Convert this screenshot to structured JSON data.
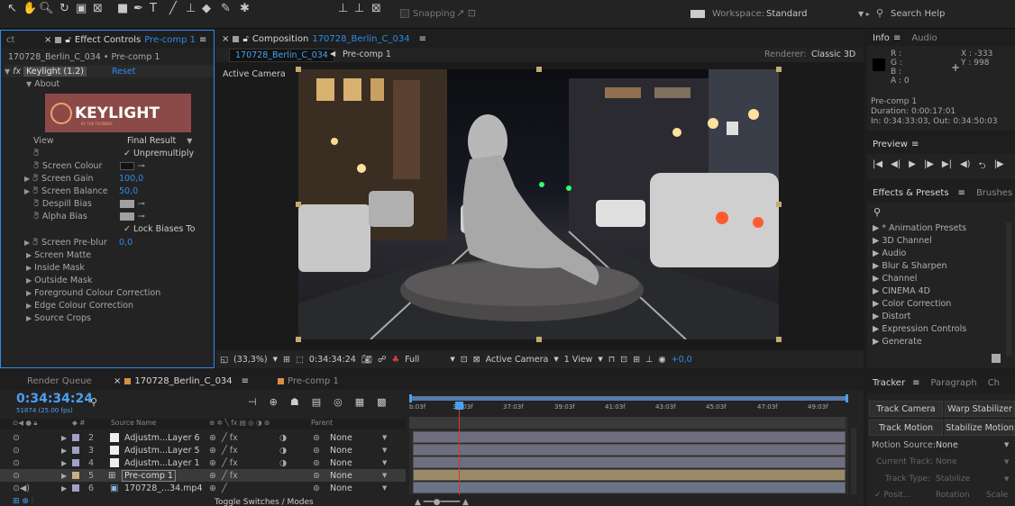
{
  "toolbar": {
    "snapping": "Snapping",
    "workspace_label": "Workspace:",
    "workspace_value": "Standard",
    "search_placeholder": "Search Help"
  },
  "effect_controls": {
    "tab_left": "ct",
    "tab_label": "Effect Controls",
    "tab_comp": "Pre-comp 1",
    "menu": "≡",
    "breadcrumb": "170728_Berlin_C_034 • Pre-comp 1",
    "effect_name": "Keylight (1.2)",
    "reset": "Reset",
    "about": "About",
    "logo_text": "KEYLIGHT",
    "logo_sub": "BY THE FOUNDRY",
    "view_label": "View",
    "view_value": "Final Result",
    "unpremultiply": "Unpremultiply",
    "screen_colour": "Screen Colour",
    "screen_gain": "Screen Gain",
    "screen_gain_val": "100,0",
    "screen_balance": "Screen Balance",
    "screen_balance_val": "50,0",
    "despill_bias": "Despill Bias",
    "alpha_bias": "Alpha Bias",
    "lock_biases": "Lock Biases To",
    "screen_preblur": "Screen Pre-blur",
    "screen_preblur_val": "0,0",
    "groups": [
      "Screen Matte",
      "Inside Mask",
      "Outside Mask",
      "Foreground Colour Correction",
      "Edge Colour Correction",
      "Source Crops"
    ]
  },
  "composition": {
    "tab_label": "Composition",
    "tab_comp": "170728_Berlin_C_034",
    "menu": "≡",
    "subtab_active": "170728_Berlin_C_034",
    "subtab_other": "Pre-comp 1",
    "renderer_label": "Renderer:",
    "renderer_value": "Classic 3D",
    "active_camera": "Active Camera",
    "zoom": "(33,3%)",
    "timecode": "0:34:34:24",
    "resolution": "Full",
    "camera": "Active Camera",
    "view_count": "1 View",
    "exposure": "+0,0"
  },
  "info": {
    "tab": "Info",
    "tab2": "Audio",
    "r": "R :",
    "g": "G :",
    "b": "B :",
    "a": "A : 0",
    "x": "X : -333",
    "y": "Y : 998",
    "layer_name": "Pre-comp 1",
    "duration": "Duration: 0:00:17:01",
    "inout": "In: 0:34:33:03, Out: 0:34:50:03"
  },
  "preview": {
    "tab": "Preview"
  },
  "effects_presets": {
    "tab": "Effects & Presets",
    "tab2": "Brushes",
    "items": [
      "* Animation Presets",
      "3D Channel",
      "Audio",
      "Blur & Sharpen",
      "Channel",
      "CINEMA 4D",
      "Color Correction",
      "Distort",
      "Expression Controls",
      "Generate"
    ]
  },
  "timeline": {
    "render_queue": "Render Queue",
    "tab_comp": "170728_Berlin_C_034",
    "tab_comp2": "Pre-comp 1",
    "timecode": "0:34:34:24",
    "fps": "51874 (25.00 fps)",
    "col_source": "Source Name",
    "col_parent": "Parent",
    "ticks": [
      "b:03f",
      "35:03f",
      "37:03f",
      "39:03f",
      "41:03f",
      "43:03f",
      "45:03f",
      "47:03f",
      "49:03f"
    ],
    "layers": [
      {
        "num": "2",
        "name": "Adjustm...Layer 6",
        "parent": "None"
      },
      {
        "num": "3",
        "name": "Adjustm...Layer 5",
        "parent": "None"
      },
      {
        "num": "4",
        "name": "Adjustm...Layer 1",
        "parent": "None"
      },
      {
        "num": "5",
        "name": "Pre-comp 1",
        "parent": "None"
      },
      {
        "num": "6",
        "name": "170728_...34.mp4",
        "parent": "None"
      }
    ],
    "toggle": "Toggle Switches / Modes"
  },
  "tracker": {
    "tab": "Tracker",
    "tab2": "Paragraph",
    "tab3": "Ch",
    "track_camera": "Track Camera",
    "warp_stabilizer": "Warp Stabilizer",
    "track_motion": "Track Motion",
    "stabilize_motion": "Stabilize Motion",
    "motion_source_label": "Motion Source:",
    "motion_source_value": "None",
    "current_track": "Current Track:",
    "current_track_value": "None",
    "track_type": "Track Type:",
    "track_type_value": "Stabilize",
    "position": "Posit...",
    "rotation": "Rotation",
    "scale": "Scale"
  }
}
